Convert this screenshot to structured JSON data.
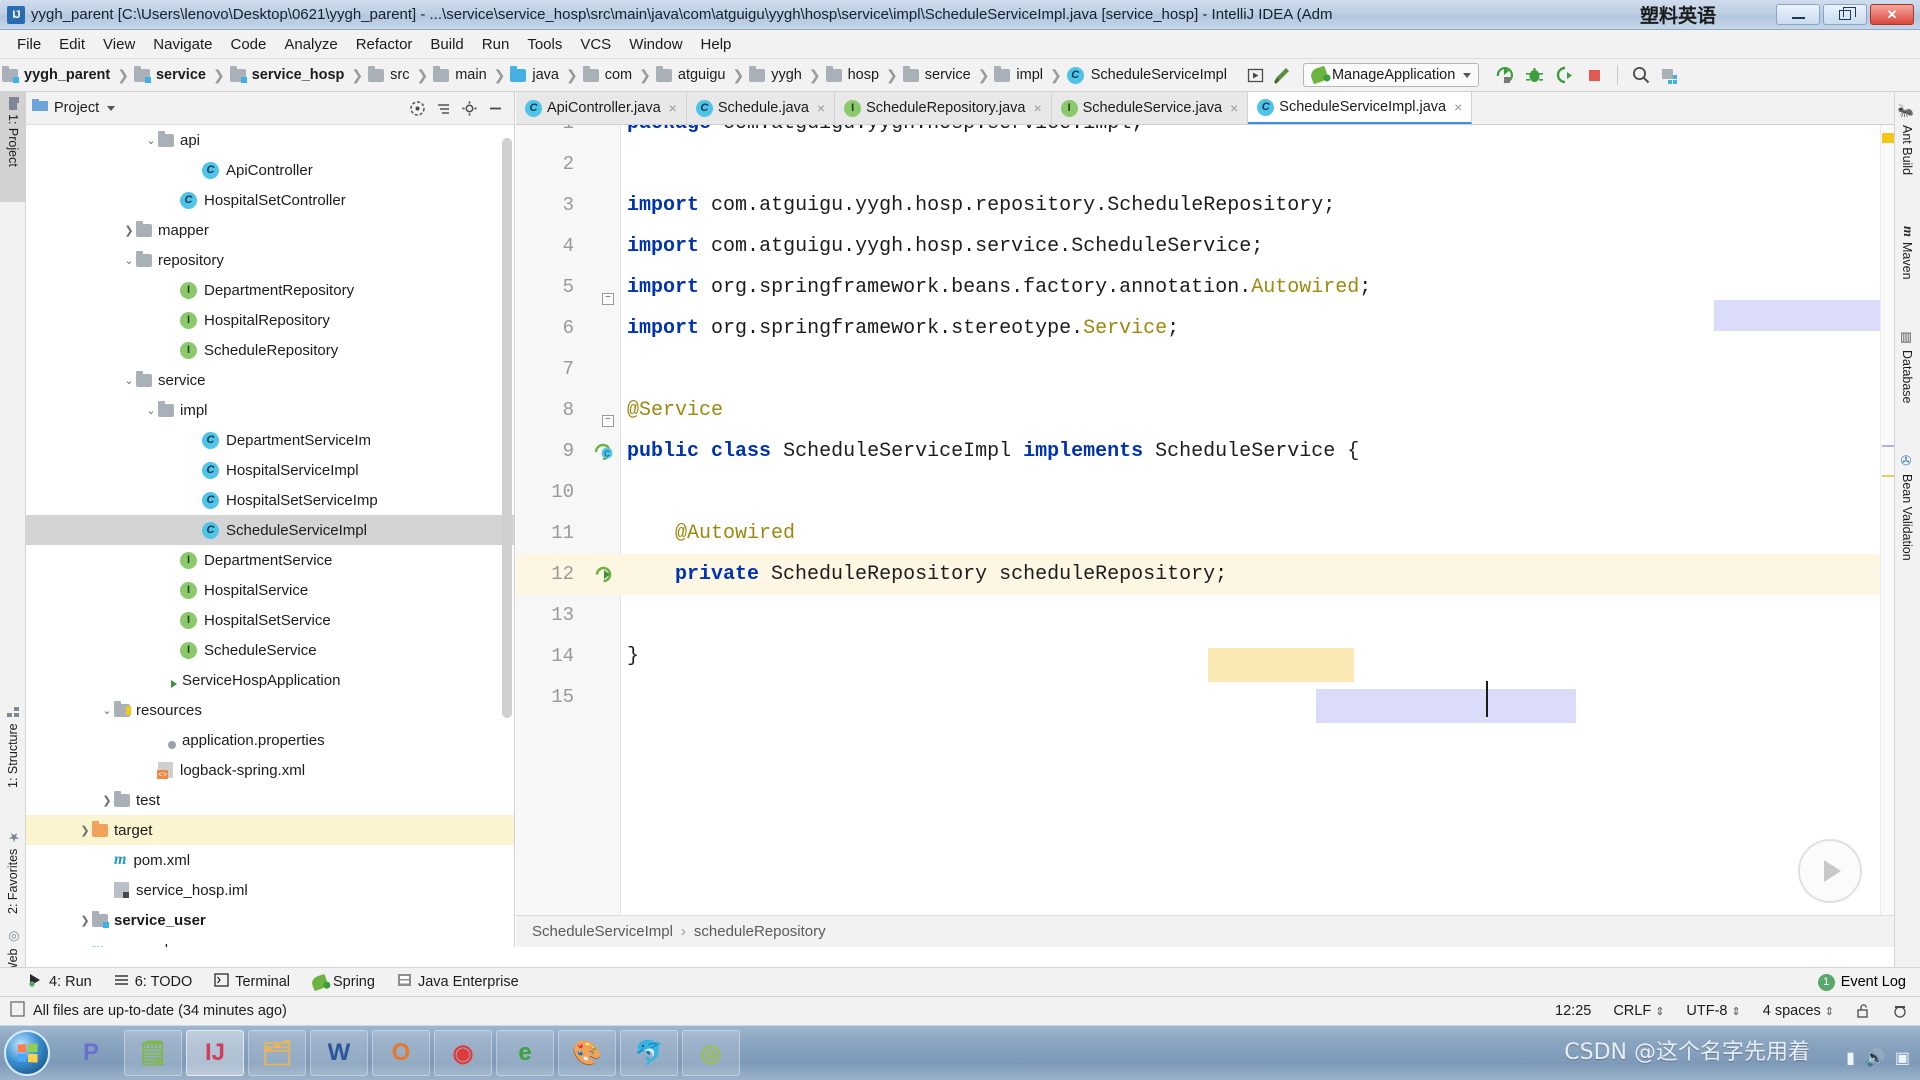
{
  "window": {
    "title": "yygh_parent [C:\\Users\\lenovo\\Desktop\\0621\\yygh_parent] - ...\\service\\service_hosp\\src\\main\\java\\com\\atguigu\\yygh\\hosp\\service\\impl\\ScheduleServiceImpl.java [service_hosp] - IntelliJ IDEA (Adm",
    "app_icon": "intellij-idea-icon",
    "watermark": "塑料英语",
    "controls": {
      "minimize": "minimize-button",
      "maximize": "maximize-button",
      "close": "close-button"
    }
  },
  "menubar": {
    "items": [
      "File",
      "Edit",
      "View",
      "Navigate",
      "Code",
      "Analyze",
      "Refactor",
      "Build",
      "Run",
      "Tools",
      "VCS",
      "Window",
      "Help"
    ]
  },
  "navbar": {
    "breadcrumbs": [
      {
        "label": "yygh_parent",
        "icon": "module-folder-icon",
        "bold": true
      },
      {
        "label": "service",
        "icon": "module-folder-icon",
        "bold": true
      },
      {
        "label": "service_hosp",
        "icon": "module-folder-icon",
        "bold": true
      },
      {
        "label": "src",
        "icon": "folder-icon",
        "bold": false
      },
      {
        "label": "main",
        "icon": "folder-icon",
        "bold": false
      },
      {
        "label": "java",
        "icon": "source-folder-icon",
        "bold": false
      },
      {
        "label": "com",
        "icon": "package-folder-icon",
        "bold": false
      },
      {
        "label": "atguigu",
        "icon": "package-folder-icon",
        "bold": false
      },
      {
        "label": "yygh",
        "icon": "package-folder-icon",
        "bold": false
      },
      {
        "label": "hosp",
        "icon": "package-folder-icon",
        "bold": false
      },
      {
        "label": "service",
        "icon": "package-folder-icon",
        "bold": false
      },
      {
        "label": "impl",
        "icon": "package-folder-icon",
        "bold": false
      },
      {
        "label": "ScheduleServiceImpl",
        "icon": "java-class-icon",
        "bold": false
      }
    ],
    "tools": [
      "preview-icon",
      "build-hammer-icon"
    ],
    "run_configuration": {
      "label": "ManageApplication",
      "icon": "spring-boot-icon",
      "dropdown": "chevron-down-icon"
    },
    "run_buttons": [
      "run-icon",
      "debug-icon",
      "run-with-coverage-icon",
      "stop-icon"
    ],
    "right_buttons": [
      "search-everywhere-icon",
      "project-structure-icon"
    ]
  },
  "left_stripe": {
    "tabs": [
      {
        "label": "1: Project",
        "icon": "project-icon",
        "selected": true
      },
      {
        "label": "1: Structure",
        "icon": "structure-icon",
        "selected": false
      },
      {
        "label": "2: Favorites",
        "icon": "star-icon",
        "selected": false
      },
      {
        "label": "Web",
        "icon": "web-icon",
        "selected": false
      }
    ]
  },
  "right_stripe": {
    "tabs": [
      {
        "label": "Ant Build",
        "icon": "ant-icon"
      },
      {
        "label": "Maven",
        "icon": "maven-icon"
      },
      {
        "label": "Database",
        "icon": "database-icon"
      },
      {
        "label": "Bean Validation",
        "icon": "bean-validation-icon"
      }
    ]
  },
  "project_panel": {
    "header": {
      "title": "Project",
      "caret": "chevron-down-icon",
      "tools": [
        "target-icon",
        "collapse-all-icon",
        "settings-gear-icon",
        "hide-icon"
      ]
    },
    "tree": [
      {
        "label": "api",
        "icon": "folder-icon",
        "indent": 5,
        "arrow": "v",
        "state": "normal"
      },
      {
        "label": "ApiController",
        "icon": "java-class-icon",
        "indent": 7,
        "arrow": "",
        "state": "normal"
      },
      {
        "label": "HospitalSetController",
        "icon": "java-class-icon",
        "indent": 6,
        "arrow": "",
        "state": "normal"
      },
      {
        "label": "mapper",
        "icon": "folder-icon",
        "indent": 4,
        "arrow": ">",
        "state": "normal"
      },
      {
        "label": "repository",
        "icon": "folder-icon",
        "indent": 4,
        "arrow": "v",
        "state": "normal"
      },
      {
        "label": "DepartmentRepository",
        "icon": "java-interface-icon",
        "indent": 6,
        "arrow": "",
        "state": "normal"
      },
      {
        "label": "HospitalRepository",
        "icon": "java-interface-icon",
        "indent": 6,
        "arrow": "",
        "state": "normal"
      },
      {
        "label": "ScheduleRepository",
        "icon": "java-interface-icon",
        "indent": 6,
        "arrow": "",
        "state": "normal"
      },
      {
        "label": "service",
        "icon": "folder-icon",
        "indent": 4,
        "arrow": "v",
        "state": "normal"
      },
      {
        "label": "impl",
        "icon": "folder-icon",
        "indent": 5,
        "arrow": "v",
        "state": "normal"
      },
      {
        "label": "DepartmentServiceIm",
        "icon": "java-class-icon",
        "indent": 7,
        "arrow": "",
        "state": "normal"
      },
      {
        "label": "HospitalServiceImpl",
        "icon": "java-class-icon",
        "indent": 7,
        "arrow": "",
        "state": "normal"
      },
      {
        "label": "HospitalSetServiceImp",
        "icon": "java-class-icon",
        "indent": 7,
        "arrow": "",
        "state": "normal"
      },
      {
        "label": "ScheduleServiceImpl",
        "icon": "java-class-icon",
        "indent": 7,
        "arrow": "",
        "state": "selected"
      },
      {
        "label": "DepartmentService",
        "icon": "java-interface-icon",
        "indent": 6,
        "arrow": "",
        "state": "normal"
      },
      {
        "label": "HospitalService",
        "icon": "java-interface-icon",
        "indent": 6,
        "arrow": "",
        "state": "normal"
      },
      {
        "label": "HospitalSetService",
        "icon": "java-interface-icon",
        "indent": 6,
        "arrow": "",
        "state": "normal"
      },
      {
        "label": "ScheduleService",
        "icon": "java-interface-icon",
        "indent": 6,
        "arrow": "",
        "state": "normal"
      },
      {
        "label": "ServiceHospApplication",
        "icon": "spring-boot-run-icon",
        "indent": 5,
        "arrow": "",
        "state": "normal"
      },
      {
        "label": "resources",
        "icon": "resources-folder-icon",
        "indent": 3,
        "arrow": "v",
        "state": "normal"
      },
      {
        "label": "application.properties",
        "icon": "spring-properties-icon",
        "indent": 5,
        "arrow": "",
        "state": "normal"
      },
      {
        "label": "logback-spring.xml",
        "icon": "xml-file-icon",
        "indent": 5,
        "arrow": "",
        "state": "normal"
      },
      {
        "label": "test",
        "icon": "folder-icon",
        "indent": 3,
        "arrow": ">",
        "state": "normal"
      },
      {
        "label": "target",
        "icon": "target-folder-icon",
        "indent": 2,
        "arrow": ">",
        "state": "highlight"
      },
      {
        "label": "pom.xml",
        "icon": "maven-pom-icon",
        "indent": 3,
        "arrow": "",
        "state": "normal"
      },
      {
        "label": "service_hosp.iml",
        "icon": "iml-file-icon",
        "indent": 3,
        "arrow": "",
        "state": "normal"
      },
      {
        "label": "service_user",
        "icon": "module-folder-icon",
        "indent": 2,
        "arrow": ">",
        "state": "bold"
      },
      {
        "label": "pom.xml",
        "icon": "maven-pom-icon",
        "indent": 2,
        "arrow": "",
        "state": "normal"
      }
    ]
  },
  "editor": {
    "tabs": [
      {
        "label": "ApiController.java",
        "icon": "java-class-icon",
        "active": false,
        "close": "×"
      },
      {
        "label": "Schedule.java",
        "icon": "java-class-icon",
        "active": false,
        "close": "×"
      },
      {
        "label": "ScheduleRepository.java",
        "icon": "java-interface-icon",
        "active": false,
        "close": "×"
      },
      {
        "label": "ScheduleService.java",
        "icon": "java-interface-icon",
        "active": false,
        "close": "×"
      },
      {
        "label": "ScheduleServiceImpl.java",
        "icon": "java-class-icon",
        "active": true,
        "close": "×"
      }
    ],
    "lines": [
      {
        "num": "1",
        "text": "package com.atguigu.yygh.hosp.service.impl;",
        "clipped": true
      },
      {
        "num": "2",
        "text": ""
      },
      {
        "num": "3",
        "text": "import com.atguigu.yygh.hosp.repository.ScheduleRepository;"
      },
      {
        "num": "4",
        "text": "import com.atguigu.yygh.hosp.service.ScheduleService;"
      },
      {
        "num": "5",
        "text": "import org.springframework.beans.factory.annotation.Autowired;"
      },
      {
        "num": "6",
        "text": "import org.springframework.stereotype.Service;"
      },
      {
        "num": "7",
        "text": ""
      },
      {
        "num": "8",
        "text": "@Service"
      },
      {
        "num": "9",
        "text": "public class ScheduleServiceImpl implements ScheduleService {"
      },
      {
        "num": "10",
        "text": ""
      },
      {
        "num": "11",
        "text": "    @Autowired"
      },
      {
        "num": "12",
        "text": "    private ScheduleRepository scheduleRepository;"
      },
      {
        "num": "13",
        "text": ""
      },
      {
        "num": "14",
        "text": "}"
      },
      {
        "num": "15",
        "text": ""
      }
    ],
    "bottom_breadcrumb": [
      "ScheduleServiceImpl",
      "scheduleRepository"
    ],
    "bottom_breadcrumb_sep": "›",
    "run_inline_button": "run-inline-icon"
  },
  "bottom_toolbar": {
    "items": [
      {
        "label": "4: Run",
        "icon": "run-icon",
        "mnemonic": "4"
      },
      {
        "label": "6: TODO",
        "icon": "todo-icon",
        "mnemonic": "6"
      },
      {
        "label": "Terminal",
        "icon": "terminal-icon"
      },
      {
        "label": "Spring",
        "icon": "spring-leaf-icon"
      },
      {
        "label": "Java Enterprise",
        "icon": "java-enterprise-icon"
      }
    ],
    "event_log": {
      "label": "Event Log",
      "count": "1"
    }
  },
  "statusbar": {
    "message": "All files are up-to-date (34 minutes ago)",
    "message_icon": "document-icon",
    "caret_position": "12:25",
    "line_separator": "CRLF",
    "encoding": "UTF-8",
    "indent": "4 spaces",
    "lock_icon": "unlocked-icon",
    "inspection_icon": "inspector-icon"
  },
  "taskbar": {
    "start": "windows-start-orb",
    "items": [
      {
        "name": "pptv-icon",
        "glyph": "P",
        "active": false
      },
      {
        "name": "notepad-icon",
        "glyph": "🗒",
        "active": false
      },
      {
        "name": "intellij-idea-icon",
        "glyph": "IJ",
        "active": true
      },
      {
        "name": "file-explorer-icon",
        "glyph": "🗂",
        "active": false
      },
      {
        "name": "microsoft-word-icon",
        "glyph": "W",
        "active": false
      },
      {
        "name": "office-icon",
        "glyph": "O",
        "active": false
      },
      {
        "name": "kugou-icon",
        "glyph": "◉",
        "active": false
      },
      {
        "name": "360-browser-icon",
        "glyph": "e",
        "active": false
      },
      {
        "name": "paint-icon",
        "glyph": "🎨",
        "active": false
      },
      {
        "name": "navicat-icon",
        "glyph": "🐬",
        "active": false
      },
      {
        "name": "app-icon",
        "glyph": "◎",
        "active": false
      }
    ],
    "watermark": "CSDN @这个名字先用着",
    "tray": [
      "network-icon",
      "volume-icon",
      "action-center-icon"
    ]
  }
}
